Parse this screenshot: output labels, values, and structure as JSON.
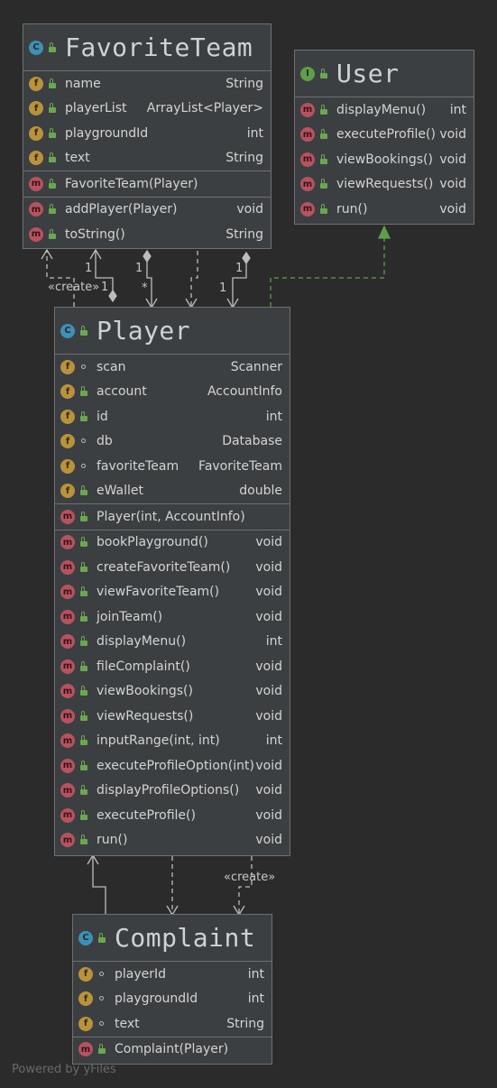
{
  "classes": {
    "favoriteTeam": {
      "name": "FavoriteTeam",
      "kind": "C",
      "fields": [
        {
          "name": "name",
          "type": "String"
        },
        {
          "name": "playerList",
          "type": "ArrayList<Player>"
        },
        {
          "name": "playgroundId",
          "type": "int"
        },
        {
          "name": "text",
          "type": "String"
        }
      ],
      "constructors": [
        {
          "name": "FavoriteTeam(Player)",
          "type": ""
        }
      ],
      "methods": [
        {
          "name": "addPlayer(Player)",
          "type": "void"
        },
        {
          "name": "toString()",
          "type": "String"
        }
      ]
    },
    "user": {
      "name": "User",
      "kind": "I",
      "methods": [
        {
          "name": "displayMenu()",
          "type": "int"
        },
        {
          "name": "executeProfile()",
          "type": "void"
        },
        {
          "name": "viewBookings()",
          "type": "void"
        },
        {
          "name": "viewRequests()",
          "type": "void"
        },
        {
          "name": "run()",
          "type": "void"
        }
      ]
    },
    "player": {
      "name": "Player",
      "kind": "C",
      "fields": [
        {
          "name": "scan",
          "type": "Scanner"
        },
        {
          "name": "account",
          "type": "AccountInfo"
        },
        {
          "name": "id",
          "type": "int"
        },
        {
          "name": "db",
          "type": "Database"
        },
        {
          "name": "favoriteTeam",
          "type": "FavoriteTeam"
        },
        {
          "name": "eWallet",
          "type": "double"
        }
      ],
      "constructors": [
        {
          "name": "Player(int, AccountInfo)",
          "type": ""
        }
      ],
      "methods": [
        {
          "name": "bookPlayground()",
          "type": "void"
        },
        {
          "name": "createFavoriteTeam()",
          "type": "void"
        },
        {
          "name": "viewFavoriteTeam()",
          "type": "void"
        },
        {
          "name": "joinTeam()",
          "type": "void"
        },
        {
          "name": "displayMenu()",
          "type": "int"
        },
        {
          "name": "fileComplaint()",
          "type": "void"
        },
        {
          "name": "viewBookings()",
          "type": "void"
        },
        {
          "name": "viewRequests()",
          "type": "void"
        },
        {
          "name": "inputRange(int, int)",
          "type": "int"
        },
        {
          "name": "executeProfileOption(int)",
          "type": "void"
        },
        {
          "name": "displayProfileOptions()",
          "type": "void"
        },
        {
          "name": "executeProfile()",
          "type": "void"
        },
        {
          "name": "run()",
          "type": "void"
        }
      ]
    },
    "complaint": {
      "name": "Complaint",
      "kind": "C",
      "fields": [
        {
          "name": "playerId",
          "type": "int"
        },
        {
          "name": "playgroundId",
          "type": "int"
        },
        {
          "name": "text",
          "type": "String"
        }
      ],
      "constructors": [
        {
          "name": "Complaint(Player)",
          "type": ""
        }
      ]
    }
  },
  "edge_labels": {
    "create_top": "«create»",
    "create_bottom": "«create»",
    "mult_1a": "1",
    "mult_1b": "1",
    "mult_1c": "1",
    "mult_star": "*",
    "mult_1d": "1",
    "mult_1e": "1"
  },
  "footer": "Powered by yFiles",
  "colors": {
    "background": "#2b2b2b",
    "box": "#3c3f41",
    "edge": "#bdbdbd",
    "realization": "#5f9e4b"
  }
}
